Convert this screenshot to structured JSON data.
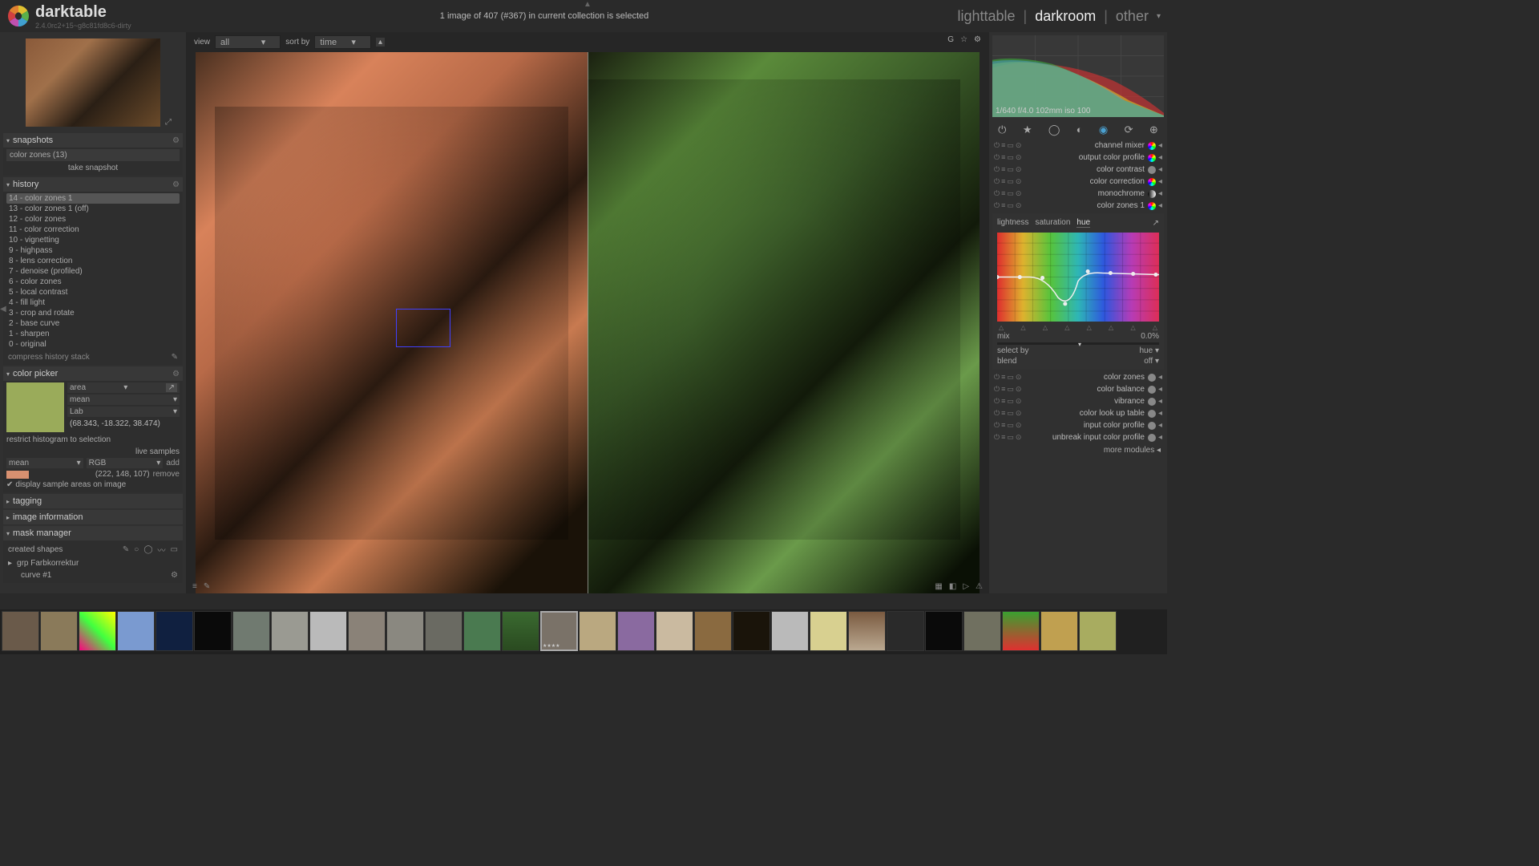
{
  "app": {
    "name": "darktable",
    "version": "2.4.0rc2+15~g8c81fd8c6-dirty"
  },
  "header": {
    "status": "1 image of 407 (#367) in current collection is selected",
    "tabs": {
      "lighttable": "lighttable",
      "darkroom": "darkroom",
      "other": "other"
    }
  },
  "center_toolbar": {
    "view_label": "view",
    "view_value": "all",
    "sort_label": "sort by",
    "sort_value": "time"
  },
  "snapshots": {
    "title": "snapshots",
    "items": [
      "color zones (13)"
    ],
    "button": "take snapshot"
  },
  "history": {
    "title": "history",
    "items": [
      "14 - color zones 1",
      "13 - color zones 1 (off)",
      "12 - color zones",
      "11 - color correction",
      "10 - vignetting",
      "9 - highpass",
      "8 - lens correction",
      "7 - denoise (profiled)",
      "6 - color zones",
      "5 - local contrast",
      "4 - fill light",
      "3 - crop and rotate",
      "2 - base curve",
      "1 - sharpen",
      "0 - original"
    ],
    "compress": "compress history stack"
  },
  "colorpicker": {
    "title": "color picker",
    "mode": "area",
    "stat": "mean",
    "space": "Lab",
    "values": "(68.343, -18.322, 38.474)",
    "restrict": "restrict histogram to selection",
    "live": "live samples",
    "mean": "mean",
    "rgb": "RGB",
    "add": "add",
    "sample_values": "(222, 148, 107)",
    "remove": "remove",
    "display_check": "display sample areas on image"
  },
  "tagging": {
    "title": "tagging"
  },
  "image_info": {
    "title": "image information"
  },
  "mask": {
    "title": "mask manager",
    "created": "created shapes",
    "grp": "grp Farbkorrektur",
    "curve": "curve #1"
  },
  "histogram": {
    "info": "1/640 f/4.0 102mm iso 100"
  },
  "modules": [
    {
      "name": "channel mixer",
      "color": "conic-gradient(red,yellow,lime,cyan,blue,magenta,red)"
    },
    {
      "name": "output color profile",
      "color": "conic-gradient(red,yellow,lime,cyan,blue,magenta,red)"
    },
    {
      "name": "color contrast",
      "color": "#888"
    },
    {
      "name": "color correction",
      "color": "conic-gradient(red,yellow,lime,cyan,blue,magenta,red)"
    },
    {
      "name": "monochrome",
      "color": "linear-gradient(90deg,#000,#fff)"
    },
    {
      "name": "color zones 1",
      "color": "conic-gradient(red,yellow,lime,cyan,blue,magenta,red)"
    }
  ],
  "color_zones": {
    "tabs": [
      "lightness",
      "saturation",
      "hue"
    ],
    "mix_label": "mix",
    "mix_value": "0.0%",
    "select_label": "select by",
    "select_value": "hue",
    "blend_label": "blend",
    "blend_value": "off"
  },
  "modules2": [
    {
      "name": "color zones"
    },
    {
      "name": "color balance"
    },
    {
      "name": "vibrance"
    },
    {
      "name": "color look up table"
    },
    {
      "name": "input color profile"
    },
    {
      "name": "unbreak input color profile"
    }
  ],
  "more_modules": "more modules",
  "filmstrip_colors": [
    "#6a5a4a",
    "#8a7a5a",
    "linear-gradient(45deg,#ff0080,#40ff40,#ffff00)",
    "#7a9ad0",
    "#102040",
    "#0a0a0a",
    "#707a70",
    "#9a9a92",
    "#bababa",
    "#8a8278",
    "#8a8880",
    "#6a6a62",
    "#4a7a50",
    "linear-gradient(#3a6a30,#2a4a20)",
    "#7a7268",
    "#baa880",
    "#8a6aa0",
    "#cabaa0",
    "#8a6a40",
    "#1a140a",
    "#bababa",
    "#d8d090",
    "linear-gradient(#7a5a40,#baa890)",
    "#2a2a2a",
    "#0a0a0a",
    "#707060",
    "linear-gradient(#3aa030,#e03030)",
    "#c0a050",
    "#a8ac60"
  ]
}
